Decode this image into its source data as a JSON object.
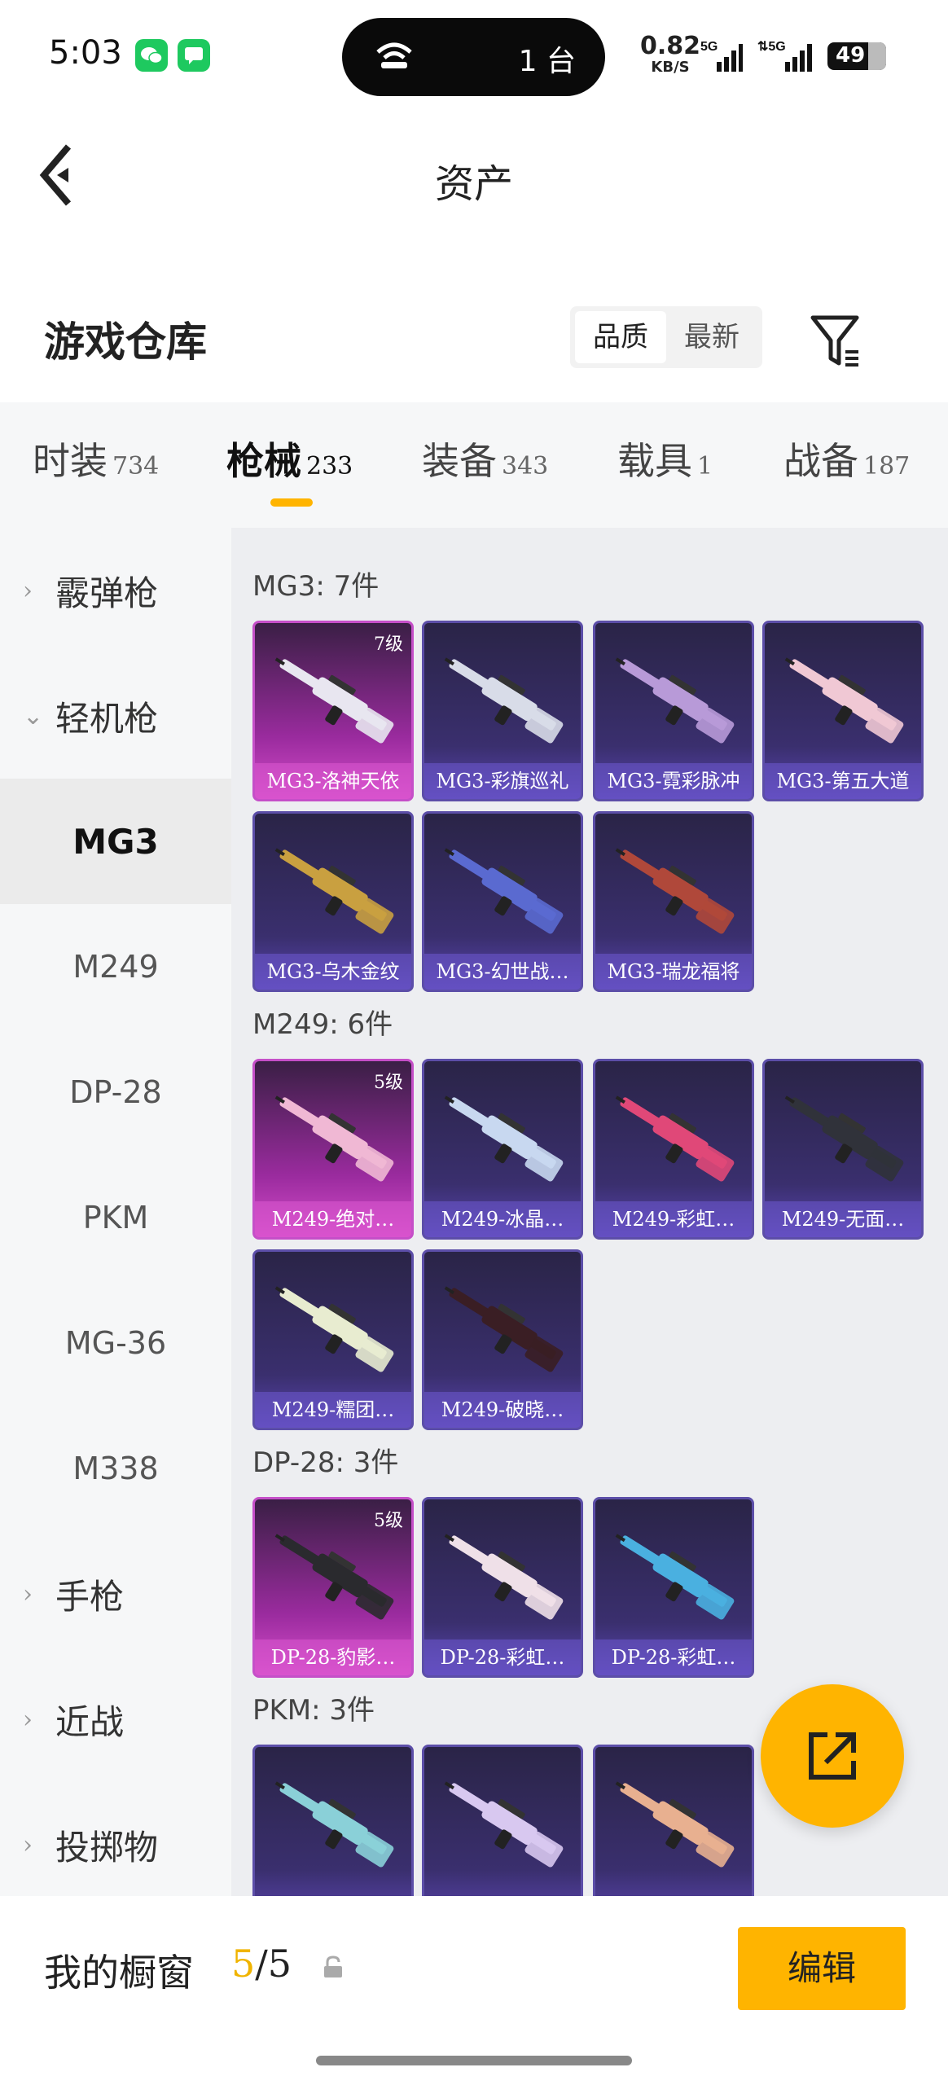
{
  "status_bar": {
    "time": "5:03",
    "island_text": "1 台",
    "net_speed": "0.82",
    "net_unit": "KB/S",
    "battery": "49",
    "icons": [
      "wechat-icon",
      "message-icon",
      "wifi-icon",
      "signal-5g-icon",
      "signal-5g-icon"
    ]
  },
  "header": {
    "title": "资产"
  },
  "warehouse": {
    "title": "游戏仓库",
    "sort_options": [
      "品质",
      "最新"
    ],
    "active_sort": "品质"
  },
  "tabs": [
    {
      "label": "时装",
      "count": "734"
    },
    {
      "label": "枪械",
      "count": "233",
      "active": true
    },
    {
      "label": "装备",
      "count": "343"
    },
    {
      "label": "载具",
      "count": "1"
    },
    {
      "label": "战备",
      "count": "187"
    }
  ],
  "sidebar": {
    "items": [
      {
        "label": "霰弹枪",
        "type": "group",
        "expanded": false
      },
      {
        "label": "轻机枪",
        "type": "group",
        "expanded": true
      },
      {
        "label": "MG3",
        "type": "sub",
        "active": true
      },
      {
        "label": "M249",
        "type": "sub"
      },
      {
        "label": "DP-28",
        "type": "sub"
      },
      {
        "label": "PKM",
        "type": "sub"
      },
      {
        "label": "MG-36",
        "type": "sub"
      },
      {
        "label": "M338",
        "type": "sub"
      },
      {
        "label": "手枪",
        "type": "group",
        "expanded": false
      },
      {
        "label": "近战",
        "type": "group",
        "expanded": false
      },
      {
        "label": "投掷物",
        "type": "group",
        "expanded": false
      }
    ]
  },
  "groups": [
    {
      "title": "MG3: 7件",
      "items": [
        {
          "name": "MG3-洛神天依",
          "level": "7级",
          "tier": "gold",
          "gun_color": "#e8e6f0"
        },
        {
          "name": "MG3-彩旗巡礼",
          "tier": "purple",
          "gun_color": "#d8dce8"
        },
        {
          "name": "MG3-霓彩脉冲",
          "tier": "purple",
          "gun_color": "#b89ad8"
        },
        {
          "name": "MG3-第五大道",
          "tier": "purple",
          "gun_color": "#f0c8d4"
        },
        {
          "name": "MG3-乌木金纹",
          "tier": "purple",
          "gun_color": "#c9a040"
        },
        {
          "name": "MG3-幻世战…",
          "tier": "purple",
          "gun_color": "#5a6ad0"
        },
        {
          "name": "MG3-瑞龙福将",
          "tier": "purple",
          "gun_color": "#b0483a"
        }
      ]
    },
    {
      "title": "M249: 6件",
      "items": [
        {
          "name": "M249-绝对…",
          "level": "5级",
          "tier": "gold",
          "gun_color": "#f0b8d4"
        },
        {
          "name": "M249-冰晶…",
          "tier": "purple",
          "gun_color": "#c8d8f0"
        },
        {
          "name": "M249-彩虹…",
          "tier": "purple",
          "gun_color": "#e04878"
        },
        {
          "name": "M249-无面…",
          "tier": "purple",
          "gun_color": "#30323a"
        },
        {
          "name": "M249-糯团…",
          "tier": "purple",
          "gun_color": "#e8ecd0"
        },
        {
          "name": "M249-破晓…",
          "tier": "purple",
          "gun_color": "#3a1e24"
        }
      ]
    },
    {
      "title": "DP-28: 3件",
      "items": [
        {
          "name": "DP-28-豹影…",
          "level": "5级",
          "tier": "gold",
          "gun_color": "#2a2a2e"
        },
        {
          "name": "DP-28-彩虹…",
          "tier": "purple",
          "gun_color": "#efe0e8"
        },
        {
          "name": "DP-28-彩虹…",
          "tier": "purple",
          "gun_color": "#4ab0e0"
        }
      ]
    },
    {
      "title": "PKM: 3件",
      "items": [
        {
          "name": "",
          "tier": "purple",
          "gun_color": "#8ad0d8"
        },
        {
          "name": "",
          "tier": "purple",
          "gun_color": "#d8c8f0"
        },
        {
          "name": "",
          "tier": "purple",
          "gun_color": "#e8b090"
        }
      ]
    }
  ],
  "bottom": {
    "showcase_label": "我的橱窗",
    "showcase_used": "5",
    "showcase_sep": "/",
    "showcase_total": "5",
    "edit_label": "编辑"
  },
  "colors": {
    "accent": "#ffb400",
    "gold_tier": "#c54fc8",
    "purple_tier": "#5c4ea8"
  }
}
